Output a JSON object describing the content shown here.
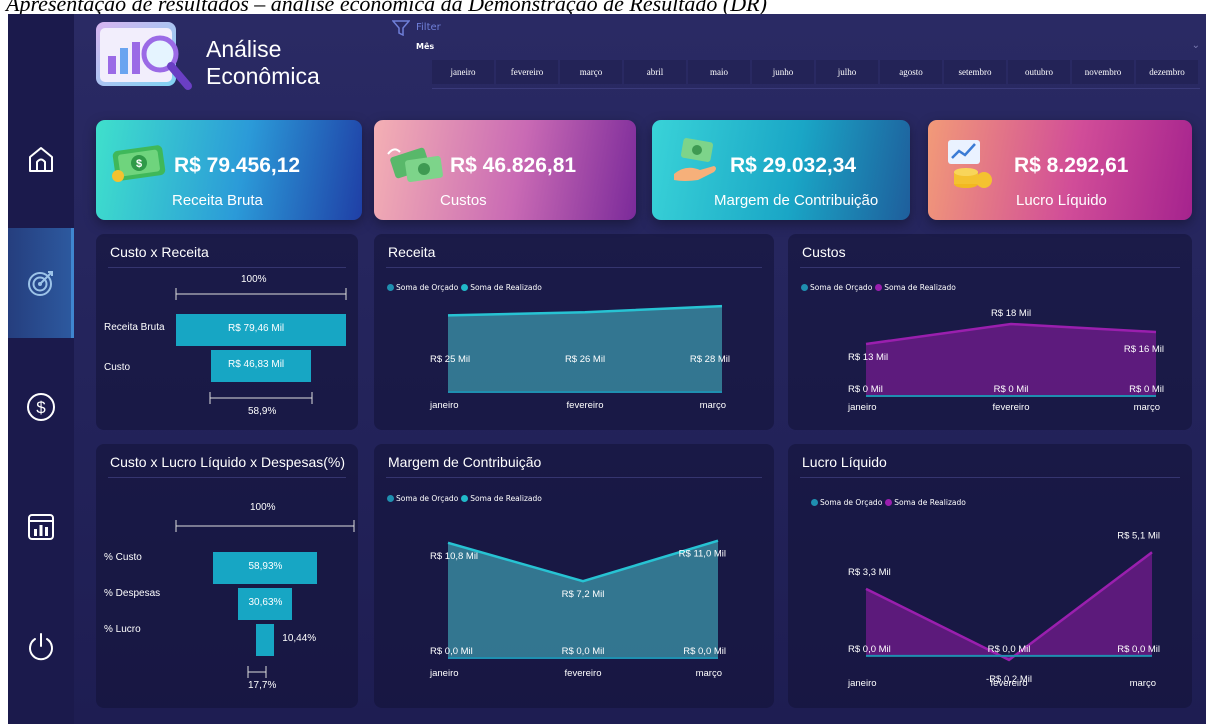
{
  "caption": "Apresentação de resultados – análise econômica da Demonstração de Resultado (DR)",
  "app": {
    "title_line1": "Análise",
    "title_line2": "Econômica"
  },
  "sidebar": [
    {
      "icon": "home-icon"
    },
    {
      "icon": "target-icon"
    },
    {
      "icon": "dollar-icon"
    },
    {
      "icon": "calendar-chart-icon"
    },
    {
      "icon": "power-icon"
    }
  ],
  "filter": {
    "label": "Filter",
    "field": "Mês",
    "months": [
      "janeiro",
      "fevereiro",
      "março",
      "abril",
      "maio",
      "junho",
      "julho",
      "agosto",
      "setembro",
      "outubro",
      "novembro",
      "dezembro"
    ]
  },
  "kpis": [
    {
      "value": "R$ 79.456,12",
      "label": "Receita Bruta",
      "icon": "money-bill-icon"
    },
    {
      "value": "R$ 46.826,81",
      "label": "Custos",
      "icon": "flying-money-icon"
    },
    {
      "value": "R$ 29.032,34",
      "label": "Margem de Contribuição",
      "icon": "money-hand-icon"
    },
    {
      "value": "R$ 8.292,61",
      "label": "Lucro Líquido",
      "icon": "growth-coins-icon"
    }
  ],
  "colors": {
    "bar": "#17a6c4",
    "orcado": "#1f8fb0",
    "realizado_teal": "#21b9c9",
    "realizado_purple": "#9a1fae"
  },
  "custo_receita": {
    "title": "Custo x Receita",
    "top_pct": "100%",
    "bottom_pct": "58,9%",
    "rows": [
      {
        "label": "Receita Bruta",
        "bar_label": "R$ 79,46 Mil",
        "fraction": 1.0
      },
      {
        "label": "Custo",
        "bar_label": "R$ 46,83 Mil",
        "fraction": 0.589
      }
    ]
  },
  "despesas": {
    "title": "Custo x Lucro Líquido x Despesas(%)",
    "top_pct": "100%",
    "bottom_pct": "17,7%",
    "rows": [
      {
        "label": "% Custo",
        "bar_label": "58,93%",
        "fraction": 0.5893
      },
      {
        "label": "% Despesas",
        "bar_label": "30,63%",
        "fraction": 0.3063
      },
      {
        "label": "% Lucro",
        "bar_label": "10,44%",
        "fraction": 0.1044
      }
    ]
  },
  "chart_data": [
    {
      "type": "area",
      "title": "Receita",
      "categories": [
        "janeiro",
        "fevereiro",
        "março"
      ],
      "legend": [
        "Soma de Orçado",
        "Soma de Realizado"
      ],
      "series": [
        {
          "name": "Soma de Orçado",
          "values": [
            0,
            0,
            0
          ]
        },
        {
          "name": "Soma de Realizado",
          "values": [
            25,
            26,
            28
          ],
          "labels": [
            "R$ 25 Mil",
            "R$ 26 Mil",
            "R$ 28 Mil"
          ]
        }
      ],
      "ylim": [
        0,
        30
      ],
      "color": "teal"
    },
    {
      "type": "area",
      "title": "Custos",
      "categories": [
        "janeiro",
        "fevereiro",
        "março"
      ],
      "legend": [
        "Soma de Orçado",
        "Soma de Realizado"
      ],
      "series": [
        {
          "name": "Soma de Orçado",
          "values": [
            0,
            0,
            0
          ],
          "labels": [
            "R$ 0 Mil",
            "R$ 0 Mil",
            "R$ 0 Mil"
          ]
        },
        {
          "name": "Soma de Realizado",
          "values": [
            13,
            18,
            16
          ],
          "labels": [
            "R$ 13 Mil",
            "R$ 18 Mil",
            "R$ 16 Mil"
          ]
        }
      ],
      "ylim": [
        0,
        20
      ],
      "color": "purple"
    },
    {
      "type": "area",
      "title": "Margem de Contribuição",
      "categories": [
        "janeiro",
        "fevereiro",
        "março"
      ],
      "legend": [
        "Soma de Orçado",
        "Soma de Realizado"
      ],
      "series": [
        {
          "name": "Soma de Orçado",
          "values": [
            0,
            0,
            0
          ],
          "labels": [
            "R$ 0,0 Mil",
            "R$ 0,0 Mil",
            "R$ 0,0 Mil"
          ]
        },
        {
          "name": "Soma de Realizado",
          "values": [
            10.8,
            7.2,
            11.0
          ],
          "labels": [
            "R$ 10,8 Mil",
            "R$ 7,2 Mil",
            "R$ 11,0 Mil"
          ]
        }
      ],
      "ylim": [
        0,
        12
      ],
      "color": "teal"
    },
    {
      "type": "area",
      "title": "Lucro Líquido",
      "categories": [
        "janeiro",
        "fevereiro",
        "março"
      ],
      "legend": [
        "Soma de Orçado",
        "Soma de Realizado"
      ],
      "series": [
        {
          "name": "Soma de Orçado",
          "values": [
            0,
            0,
            0
          ],
          "labels": [
            "R$ 0,0 Mil",
            "R$ 0,0 Mil",
            "R$ 0,0 Mil"
          ]
        },
        {
          "name": "Soma de Realizado",
          "values": [
            3.3,
            -0.2,
            5.1
          ],
          "labels": [
            "R$ 3,3 Mil",
            "-R$ 0,2 Mil",
            "R$ 5,1 Mil"
          ]
        }
      ],
      "ylim": [
        -0.5,
        6
      ],
      "color": "purple"
    }
  ]
}
